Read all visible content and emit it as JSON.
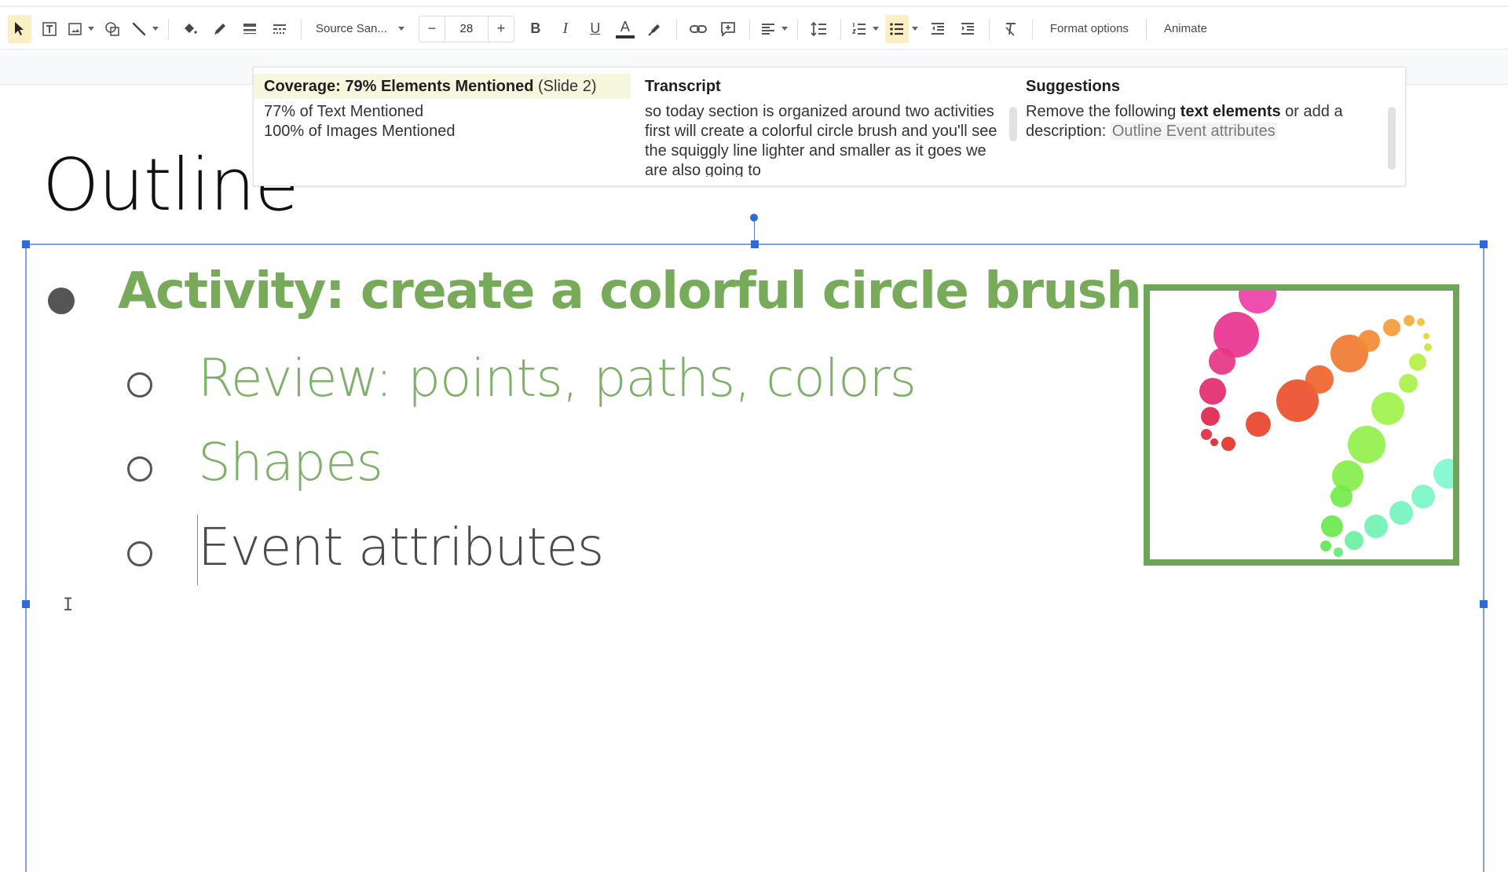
{
  "toolbar": {
    "tools": [
      {
        "name": "select-tool",
        "icon": "cursor-arrow-icon",
        "active": true
      },
      {
        "name": "text-box-tool",
        "icon": "text-box-icon"
      },
      {
        "name": "image-tool",
        "icon": "image-icon",
        "dropdown": true
      },
      {
        "name": "shape-tool",
        "icon": "shape-icon"
      },
      {
        "name": "line-tool",
        "icon": "line-icon",
        "dropdown": true
      },
      {
        "name": "fill-color",
        "icon": "paint-bucket-icon"
      },
      {
        "name": "border-color",
        "icon": "pencil-icon"
      },
      {
        "name": "border-weight",
        "icon": "line-weight-icon"
      },
      {
        "name": "border-dash",
        "icon": "line-dash-icon"
      }
    ],
    "font_name": "Source San...",
    "font_size": "28",
    "decrease_label": "−",
    "increase_label": "+",
    "bold_label": "B",
    "italic_label": "I",
    "underline_label": "U",
    "text_color_label": "A",
    "format_options_label": "Format options",
    "animate_label": "Animate",
    "accent_active_bg": "#fbefc4"
  },
  "panel": {
    "coverage": {
      "heading_bold": "Coverage: 79% Elements Mentioned",
      "heading_slide": "(Slide 2)",
      "lines": [
        "77% of Text Mentioned",
        "100% of Images Mentioned"
      ]
    },
    "transcript": {
      "heading": "Transcript",
      "text": "so today section is organized around two activities first will create a colorful circle brush and you'll see the squiggly line lighter and smaller as it goes we are also going to"
    },
    "suggestions": {
      "heading": "Suggestions",
      "prefix": "Remove the following ",
      "bold": "text elements",
      "middle": " or add a description: ",
      "highlight": "Outline Event attributes"
    }
  },
  "slide": {
    "title": "Outline",
    "headline": "Activity: create a colorful circle brush",
    "subitems": [
      {
        "text": "Review: points, paths, colors",
        "color": "#7fb069"
      },
      {
        "text": "Shapes",
        "color": "#7fb069"
      },
      {
        "text": "Event attributes",
        "color": "#4a4a4a"
      }
    ],
    "headline_color": "#77ab5a",
    "image_frame_color": "#6ea657"
  }
}
